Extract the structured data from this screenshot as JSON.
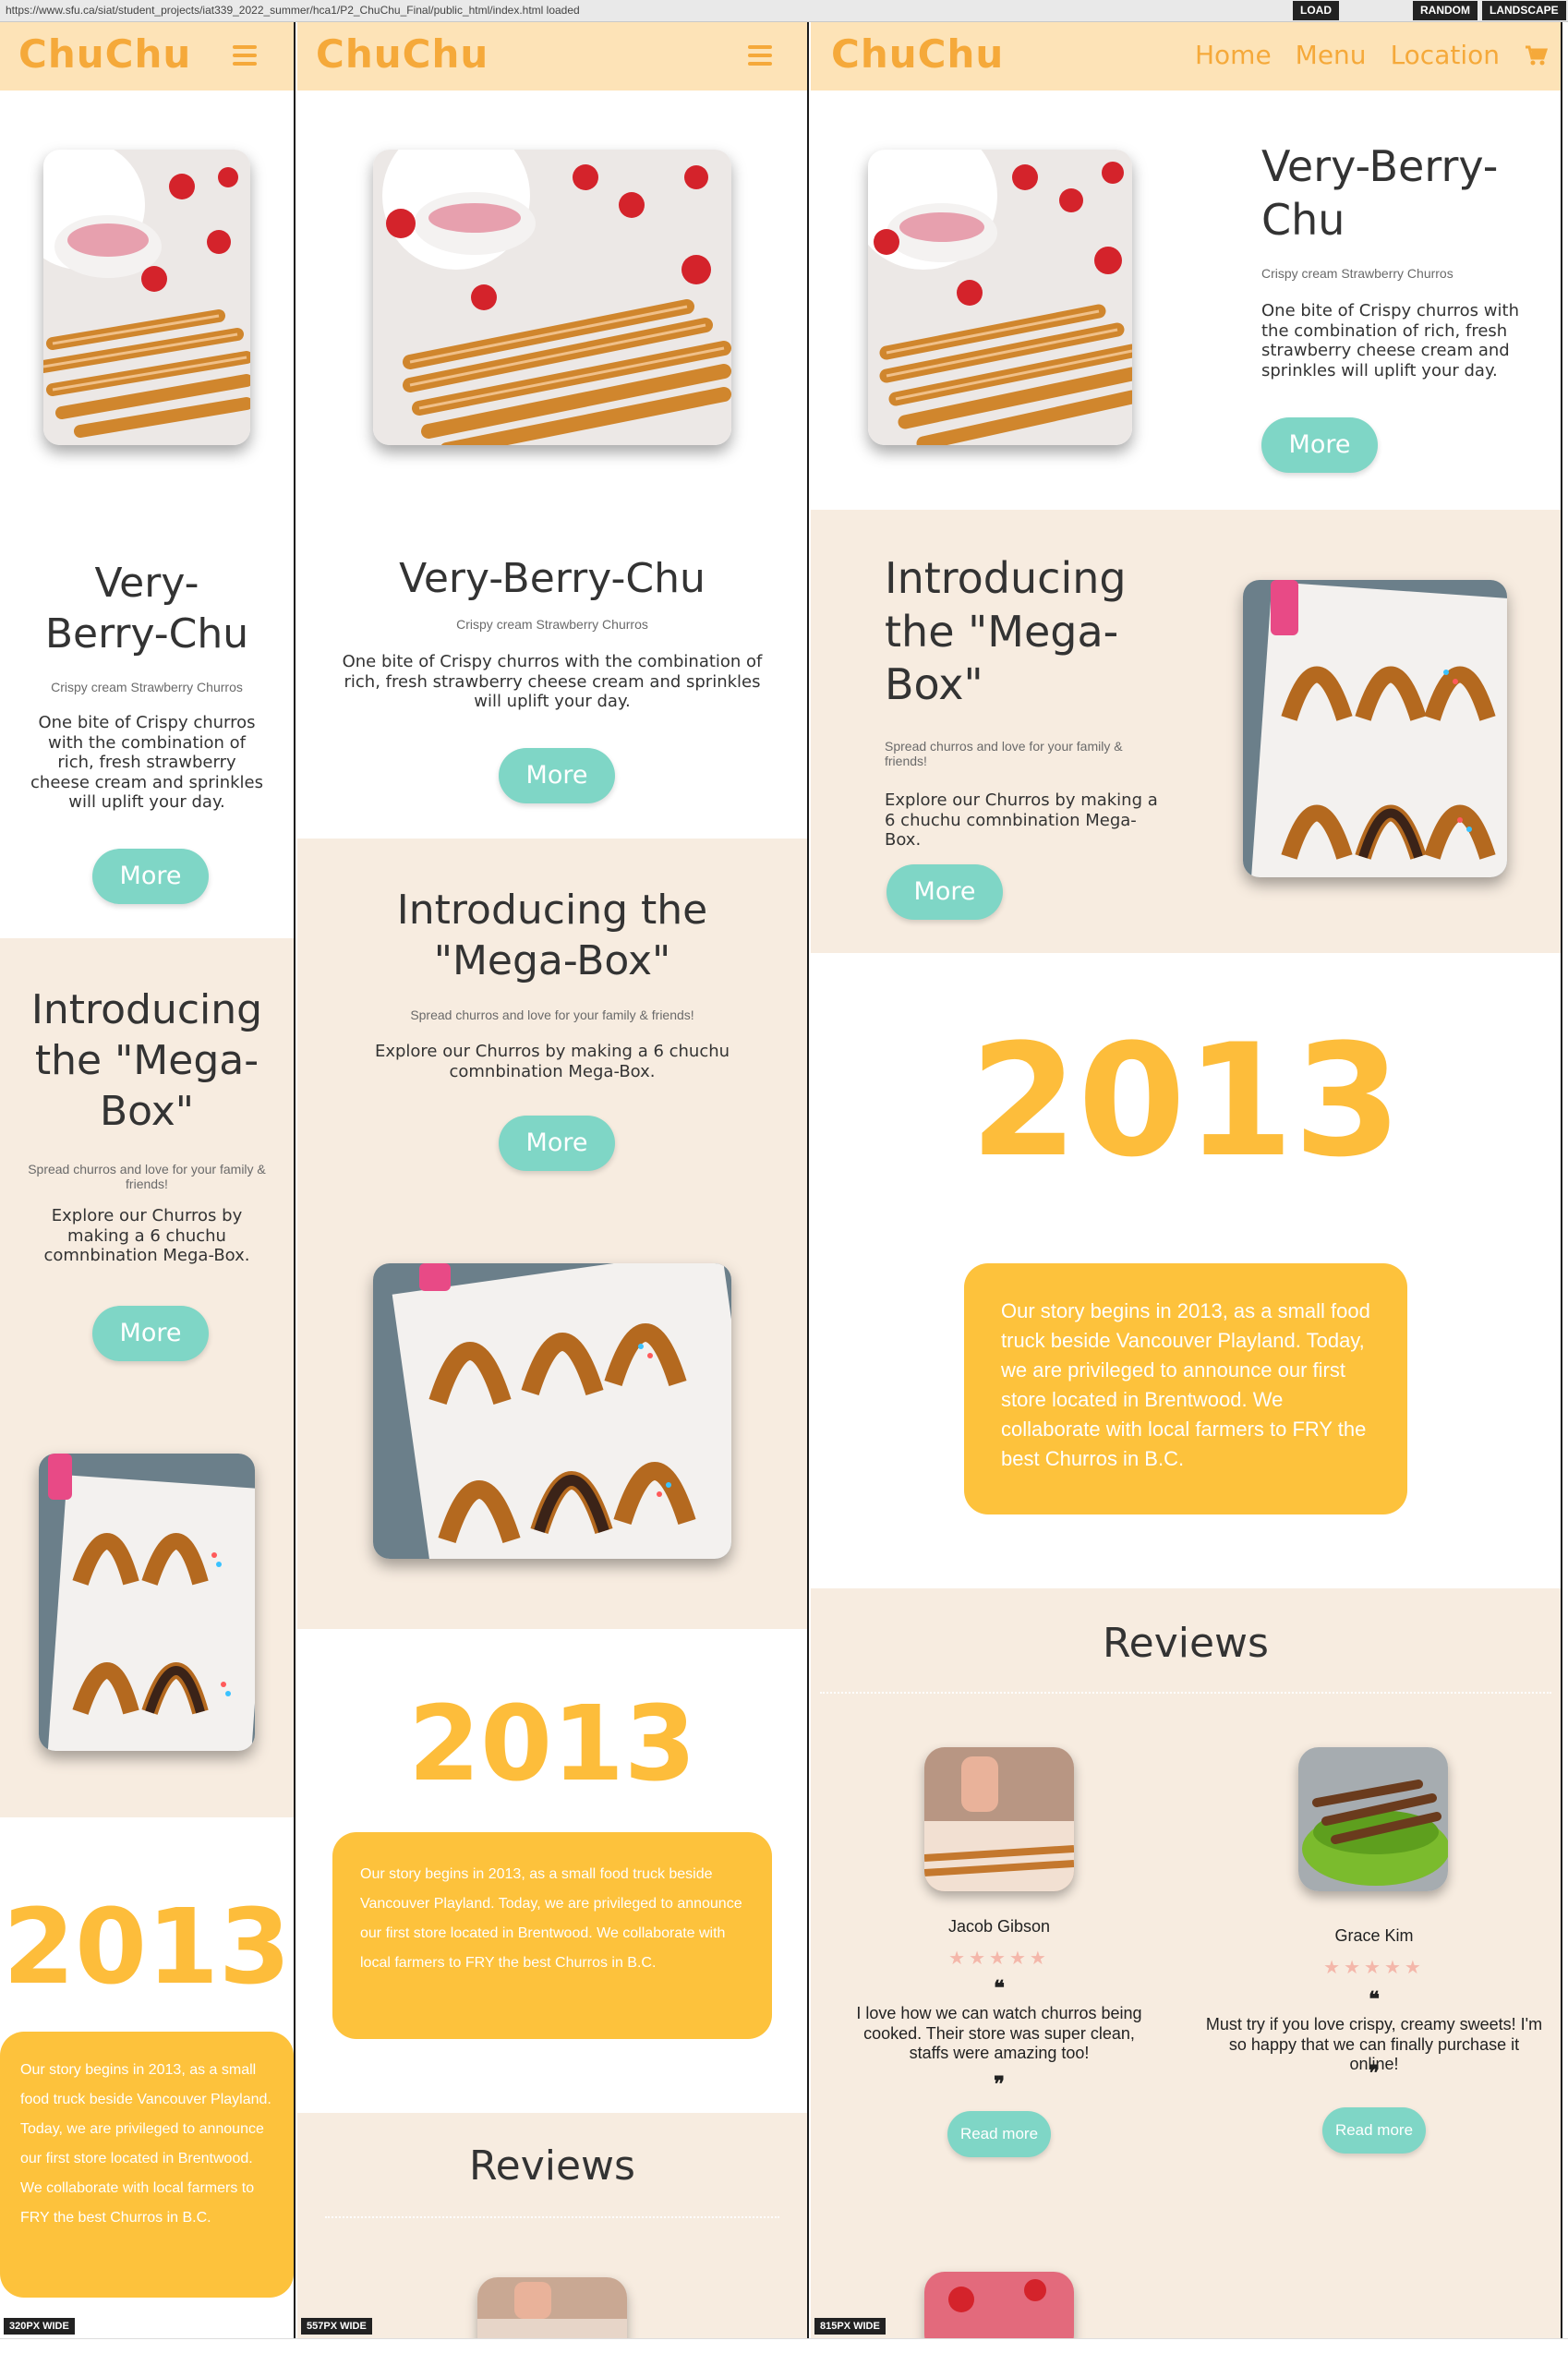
{
  "browser": {
    "url": "https://www.sfu.ca/siat/student_projects/iat339_2022_summer/hca1/P2_ChuChu_Final/public_html/index.html loaded",
    "load_label": "LOAD",
    "random_label": "RANDOM",
    "landscape_label": "LANDSCAPE"
  },
  "site": {
    "logo": "ChuChu",
    "nav": {
      "home": "Home",
      "menu": "Menu",
      "location": "Location"
    }
  },
  "hero": {
    "title": "Very-Berry-Chu",
    "title_line1": "Very-",
    "title_line2": "Berry-Chu",
    "title_wide_line1": "Very-Berry-",
    "title_wide_line2": "Chu",
    "subtitle": "Crispy cream Strawberry Churros",
    "description": "One bite of Crispy churros with the combination of rich, fresh strawberry cheese cream and sprinkles will uplift your day.",
    "button": "More"
  },
  "megabox": {
    "title": "Introducing the \"Mega-Box\"",
    "subtitle": "Spread churros and love for your family & friends!",
    "description": "Explore our Churros by making a 6 chuchu comnbination Mega-Box.",
    "button": "More"
  },
  "story": {
    "year": "2013",
    "text": "Our story begins in 2013, as a small food truck beside Vancouver Playland. Today, we are privileged to announce our first store located in Brentwood. We collaborate with local farmers to FRY the best Churros in B.C."
  },
  "reviews": {
    "title": "Reviews",
    "items": [
      {
        "name": "Jacob Gibson",
        "stars": "★★★★★",
        "text": "I love how we can watch churros being cooked. Their store was super clean, staffs were amazing too!",
        "button": "Read more"
      },
      {
        "name": "Grace Kim",
        "stars": "★★★★★",
        "text": "Must try if you love crispy, creamy sweets! I'm so happy that we can finally purchase it online!",
        "button": "Read more"
      }
    ],
    "open_quote": "❝",
    "close_quote": "❞"
  },
  "badges": {
    "w320": "320PX WIDE",
    "w557": "557PX WIDE",
    "w815": "815PX WIDE"
  },
  "colors": {
    "nav_bg": "#fde3b7",
    "logo": "#f5a93a",
    "accent_button": "#7fd6c6",
    "section_beige": "#f7ece0",
    "story_yellow": "#fdc23c"
  },
  "icons": {
    "menu": "hamburger-icon",
    "cart": "cart-icon",
    "quote": "quote-icon",
    "star": "star-icon"
  }
}
